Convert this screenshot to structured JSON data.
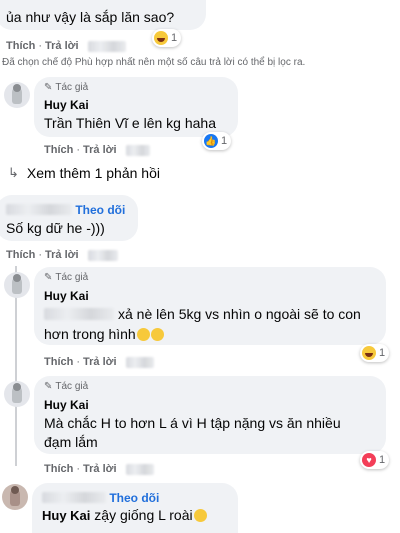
{
  "comments": [
    {
      "text": "ủa như vậy là sắp lăn sao?",
      "actions": {
        "like": "Thích",
        "sep": "·",
        "reply": "Trả lời"
      },
      "reaction_count": "1",
      "reaction_icon": "haha-emoji"
    }
  ],
  "filter_note": "Đã chọn chế độ Phù hợp nhất nên một số câu trả lời có thể bị lọc ra.",
  "reply1": {
    "author_tag": "Tác giả",
    "name": "Huy Kai",
    "text": "Trần Thiên Vĩ e lên kg haha",
    "actions": {
      "like": "Thích",
      "sep": "·",
      "reply": "Trả lời"
    },
    "reaction_count": "1",
    "reaction_icon": "like-emoji"
  },
  "view_more": "Xem thêm 1 phản hồi",
  "comment2": {
    "follow": "Theo dõi",
    "text": "Số kg dữ he -)))",
    "actions": {
      "like": "Thích",
      "sep": "·",
      "reply": "Trả lời"
    }
  },
  "reply2": {
    "author_tag": "Tác giả",
    "name": "Huy Kai",
    "text_line1": "xả nè lên 5kg vs nhìn o ngoài sẽ to con",
    "text_line2": "hơn trong hình",
    "actions": {
      "like": "Thích",
      "sep": "·",
      "reply": "Trả lời"
    },
    "reaction_count": "1",
    "reaction_icon": "haha-emoji"
  },
  "reply3": {
    "author_tag": "Tác giả",
    "name": "Huy Kai",
    "text_line1": "Mà chắc H to hơn L á vì H tập nặng vs ăn nhiều",
    "text_line2": "đạm lắm",
    "actions": {
      "like": "Thích",
      "sep": "·",
      "reply": "Trả lời"
    },
    "reaction_count": "1",
    "reaction_icon": "love-emoji"
  },
  "comment3": {
    "follow": "Theo dõi",
    "mention": "Huy Kai",
    "text": "zậy giống L roài"
  },
  "colors": {
    "link": "#216fdb",
    "muted": "#65676b",
    "bubble": "#f0f2f5"
  }
}
